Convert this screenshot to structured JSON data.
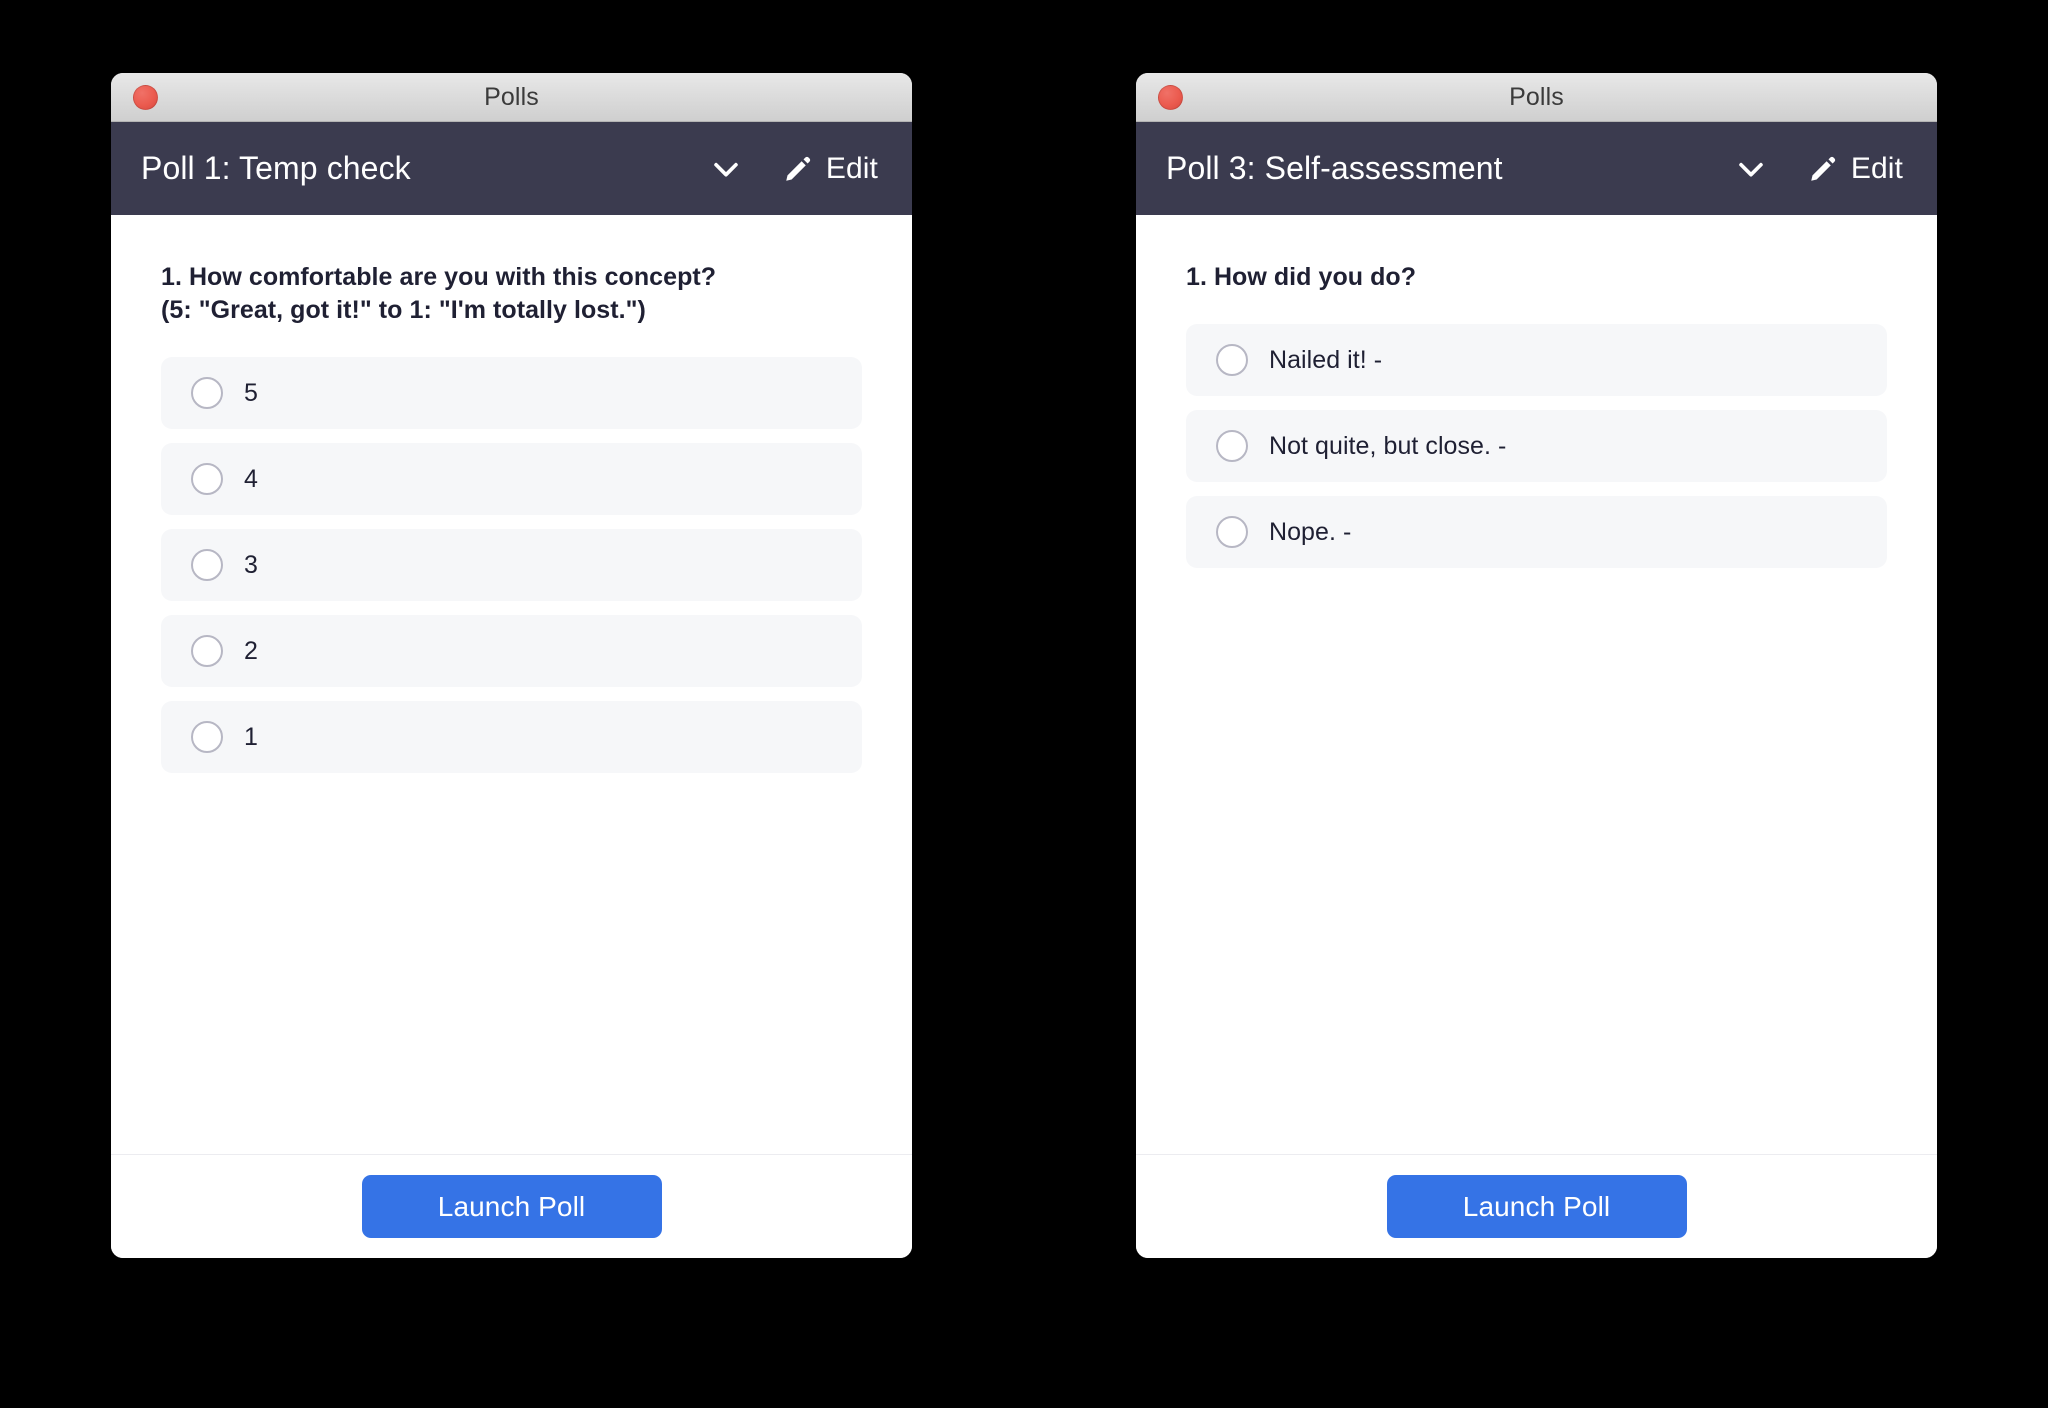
{
  "colors": {
    "header_navy": "#3b3b4f",
    "accent_blue": "#3573e6",
    "close_red": "#eb5b4f",
    "option_row_bg": "#f6f7f9",
    "radio_border": "#b7b7c4",
    "text_dark": "#1f2033"
  },
  "windows": [
    {
      "titlebar": {
        "title": "Polls",
        "close_icon": "close-traffic-light-icon"
      },
      "header": {
        "poll_title": "Poll 1: Temp check",
        "chevron_icon": "chevron-down-icon",
        "edit_icon": "pencil-icon",
        "edit_label": "Edit"
      },
      "question": "1. How comfortable are you with this concept?\n(5: \"Great, got it!\" to 1: \"I'm totally lost.\")",
      "options": [
        {
          "label": "5",
          "selected": false
        },
        {
          "label": "4",
          "selected": false
        },
        {
          "label": "3",
          "selected": false
        },
        {
          "label": "2",
          "selected": false
        },
        {
          "label": "1",
          "selected": false
        }
      ],
      "footer": {
        "launch_label": "Launch Poll"
      }
    },
    {
      "titlebar": {
        "title": "Polls",
        "close_icon": "close-traffic-light-icon"
      },
      "header": {
        "poll_title": "Poll 3: Self-assessment",
        "chevron_icon": "chevron-down-icon",
        "edit_icon": "pencil-icon",
        "edit_label": "Edit"
      },
      "question": "1. How did you do?",
      "options": [
        {
          "label": "Nailed it! -",
          "selected": false
        },
        {
          "label": "Not quite, but close. -",
          "selected": false
        },
        {
          "label": "Nope. -",
          "selected": false
        }
      ],
      "footer": {
        "launch_label": "Launch Poll"
      }
    }
  ]
}
